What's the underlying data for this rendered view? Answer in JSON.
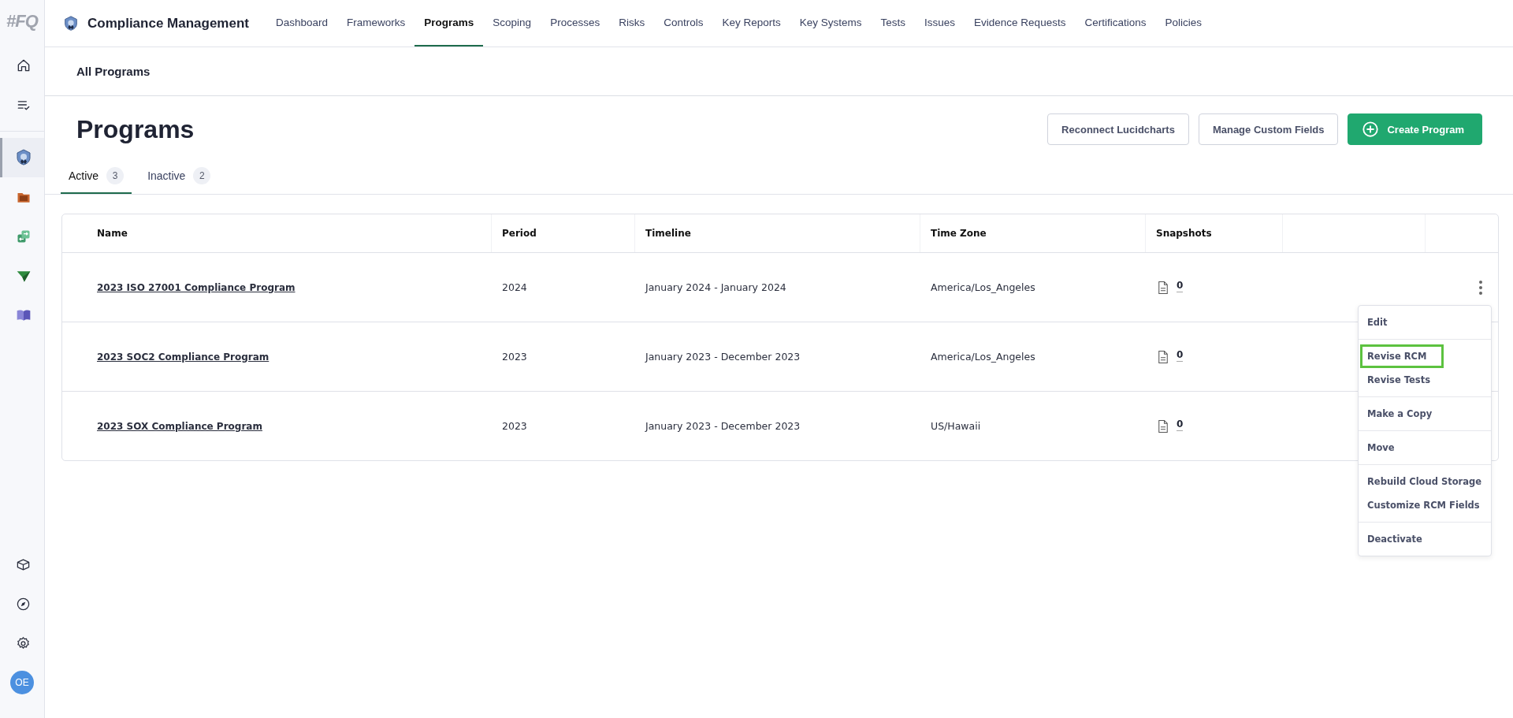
{
  "sidebar": {
    "logo": "#FQ",
    "items": [
      {
        "selected": false
      },
      {
        "selected": false
      },
      {
        "selected": true
      },
      {
        "selected": false
      },
      {
        "selected": false
      },
      {
        "selected": false
      },
      {
        "selected": false
      }
    ],
    "avatar": "OE"
  },
  "app_title": "Compliance Management",
  "nav": [
    {
      "label": "Dashboard",
      "selected": false
    },
    {
      "label": "Frameworks",
      "selected": false
    },
    {
      "label": "Programs",
      "selected": true
    },
    {
      "label": "Scoping",
      "selected": false
    },
    {
      "label": "Processes",
      "selected": false
    },
    {
      "label": "Risks",
      "selected": false
    },
    {
      "label": "Controls",
      "selected": false
    },
    {
      "label": "Key Reports",
      "selected": false
    },
    {
      "label": "Key Systems",
      "selected": false
    },
    {
      "label": "Tests",
      "selected": false
    },
    {
      "label": "Issues",
      "selected": false
    },
    {
      "label": "Evidence Requests",
      "selected": false
    },
    {
      "label": "Certifications",
      "selected": false
    },
    {
      "label": "Policies",
      "selected": false
    }
  ],
  "breadcrumb": "All Programs",
  "page_title": "Programs",
  "buttons": [
    {
      "label": "Reconnect Lucidcharts",
      "kind": "outline"
    },
    {
      "label": "Manage Custom Fields",
      "kind": "outline"
    },
    {
      "label": "Create Program",
      "kind": "primary"
    }
  ],
  "tabs": [
    {
      "label": "Active",
      "count": "3",
      "selected": true
    },
    {
      "label": "Inactive",
      "count": "2",
      "selected": false
    }
  ],
  "table": {
    "columns": [
      "Name",
      "Period",
      "Timeline",
      "Time Zone",
      "Snapshots"
    ],
    "rows": [
      {
        "name": "2023 ISO 27001 Compliance Program",
        "period": "2024",
        "timeline": "January 2024 - January 2024",
        "time_zone": "America/Los_Angeles",
        "snapshots": "0",
        "menu_open": true
      },
      {
        "name": "2023 SOC2 Compliance Program",
        "period": "2023",
        "timeline": "January 2023 - December 2023",
        "time_zone": "America/Los_Angeles",
        "snapshots": "0",
        "menu_open": false
      },
      {
        "name": "2023 SOX Compliance Program",
        "period": "2023",
        "timeline": "January 2023 - December 2023",
        "time_zone": "US/Hawaii",
        "snapshots": "0",
        "menu_open": false
      }
    ]
  },
  "menu": {
    "groups": [
      {
        "items": [
          {
            "label": "Edit",
            "highlighted": false
          }
        ]
      },
      {
        "items": [
          {
            "label": "Revise RCM",
            "highlighted": true
          },
          {
            "label": "Revise Tests",
            "highlighted": false
          }
        ]
      },
      {
        "items": [
          {
            "label": "Make a Copy",
            "highlighted": false
          }
        ]
      },
      {
        "items": [
          {
            "label": "Move",
            "highlighted": false
          }
        ]
      },
      {
        "items": [
          {
            "label": "Rebuild Cloud Storage",
            "highlighted": false
          },
          {
            "label": "Customize RCM Fields",
            "highlighted": false
          }
        ]
      },
      {
        "items": [
          {
            "label": "Deactivate",
            "highlighted": false
          }
        ]
      }
    ]
  }
}
